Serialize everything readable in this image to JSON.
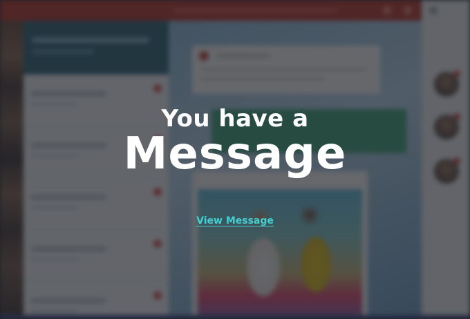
{
  "modal": {
    "subtitle": "You have a",
    "title": "Message",
    "link_label": "View Message"
  },
  "colors": {
    "overlay": "#1c1e24",
    "title_text": "#ffffff",
    "link": "#44cfd3",
    "background_topbar": "#b8352a",
    "background_sidebar_header": "#2f6477",
    "background_teal_banner": "#3fa07a"
  }
}
